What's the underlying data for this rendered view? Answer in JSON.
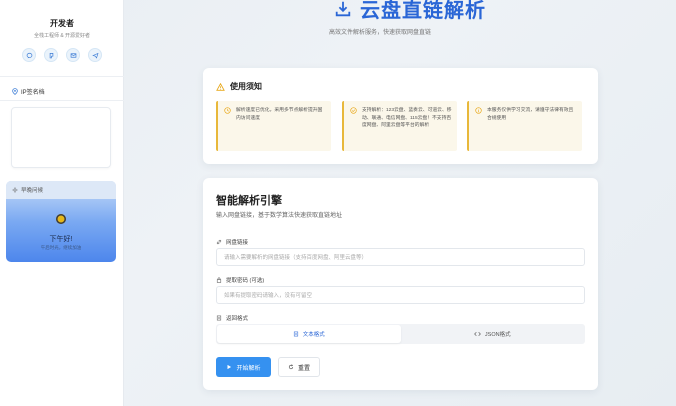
{
  "sidebar": {
    "developer_name": "开发者",
    "developer_sub": "全栈工程师 & 开源爱好者",
    "social_icons": [
      "wechat-icon",
      "qq-icon",
      "mail-icon",
      "telegram-icon"
    ],
    "ip_section_title": "IP签名档",
    "greeting_header": "早晚问候",
    "greeting_main": "下午好!",
    "greeting_sub": "午后时光，继续加油"
  },
  "header": {
    "title": "云盘直链解析",
    "subtitle": "高效文件解析服务，快速获取网盘直链"
  },
  "notice": {
    "title": "使用须知",
    "items": [
      "解析速度已优化，采用多节点解析提升国内访问速度",
      "支持解析：123云盘、蓝奏云、可道云、移动、联通、电信网盘、115云盘！不支持百度网盘、阿里云盘等平台的解析",
      "本服务仅供学习交流，请遵守法律有效且合规使用"
    ]
  },
  "engine": {
    "title": "智能解析引擎",
    "subtitle": "输入网盘链接，基于数学算法快速获取直链地址",
    "link_label": "网盘链接",
    "link_placeholder": "请输入需要解析的网盘链接（支持百度网盘、阿里云盘等）",
    "password_label": "提取密码 (可选)",
    "password_placeholder": "如果有提取密码请输入，没有可留空",
    "format_label": "返回格式",
    "format_text": "文本格式",
    "format_json": "JSON格式",
    "parse_button": "开始解析",
    "reset_button": "重置"
  },
  "colors": {
    "accent": "#2a66d6",
    "primary_button": "#3591f0",
    "notice_border": "#e8b83a"
  }
}
